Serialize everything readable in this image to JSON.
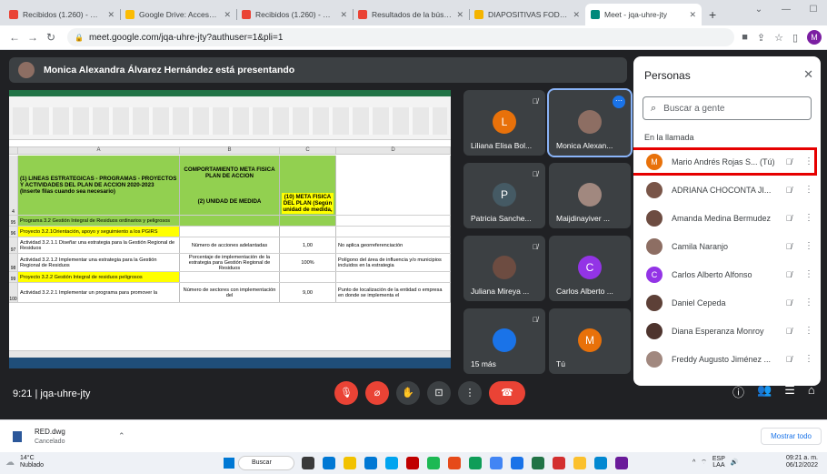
{
  "browser": {
    "tabs": [
      {
        "label": "Recibidos (1.260) - marioan",
        "color": "#ea4335"
      },
      {
        "label": "Google Drive: Acceso dene",
        "color": "#fbbc04"
      },
      {
        "label": "Recibidos (1.260) - marioan",
        "color": "#ea4335"
      },
      {
        "label": "Resultados de la búsqueda",
        "color": "#ea4335"
      },
      {
        "label": "DIAPOSITIVAS FOD-02 Seg",
        "color": "#f4b400"
      },
      {
        "label": "Meet - jqa-uhre-jty",
        "color": "#00897b"
      }
    ],
    "url": "meet.google.com/jqa-uhre-jty?authuser=1&pli=1",
    "profile_initial": "M"
  },
  "meet": {
    "presenter_text": "Monica Alexandra Álvarez Hernández está presentando",
    "meeting_time": "9:21",
    "meeting_code": "jqa-uhre-jty",
    "participants_badge": "23",
    "tiles": [
      {
        "name": "Liliana Elisa Bol...",
        "initial": "L",
        "color": "#e8710a"
      },
      {
        "name": "Monica Alexan...",
        "initial": "",
        "color": "#8d6e63"
      },
      {
        "name": "Patricia Sanche...",
        "initial": "P",
        "color": "#455a64"
      },
      {
        "name": "Maijdinayiver ...",
        "initial": "",
        "color": "#a1887f"
      },
      {
        "name": "Juliana Mireya ...",
        "initial": "",
        "color": "#6d4c41"
      },
      {
        "name": "Carlos Alberto ...",
        "initial": "C",
        "color": "#9334e6"
      },
      {
        "name": "15 más",
        "initial": "",
        "color": "#1a73e8"
      },
      {
        "name": "Tú",
        "initial": "M",
        "color": "#e8710a"
      }
    ]
  },
  "sheet": {
    "col_headers": [
      "A",
      "B",
      "C",
      "D"
    ],
    "header_a": "(1) LINEAS ESTRATEGICAS - PROGRAMAS - PROYECTOS Y ACTIVIDADES DEL PLAN DE ACCION 2020-2023",
    "header_a_note": "(Inserte filas cuando sea necesario)",
    "header_b_top": "COMPORTAMIENTO META FISICA PLAN DE ACCION",
    "header_b": "(2) UNIDAD DE MEDIDA",
    "header_c": "(10) META FISICA DEL PLAN (Según unidad de medida,",
    "rows": [
      {
        "n": "95",
        "a": "Programa 3.2 Gestión Integral de Residuos ordinarios y peligrosos",
        "b": "",
        "c": "",
        "d": "",
        "style": "green"
      },
      {
        "n": "96",
        "a": "Proyecto 3.2.1Orientación, apoyo y seguimiento a los PGIRS",
        "b": "",
        "c": "",
        "d": "",
        "style": "yellow"
      },
      {
        "n": "97",
        "a": "Actividad 3.2.1.1 Diseñar una estrategia para la Gestión Regional de Residuos",
        "b": "Número de acciones adelantadas",
        "c": "1,00",
        "d": "No aplica georreferenciación",
        "style": ""
      },
      {
        "n": "98",
        "a": "Actividad 3.2.1.2 Implementar una estrategia para la Gestión Regional de Residuos",
        "b": "Porcentaje de implementación de la estrategia para Gestión Regional de Residuos",
        "c": "100%",
        "d": "Polígono del área de influencia y/o municipios incluidos en la estrategia",
        "style": ""
      },
      {
        "n": "99",
        "a": "Proyecto 3.2.2 Gestión Integral de residuos peligrosos",
        "b": "",
        "c": "",
        "d": "",
        "style": "yellow"
      },
      {
        "n": "100",
        "a": "Actividad 3.2.2.1 Implementar un programa para promover la",
        "b": "Número de sectores con implementación del",
        "c": "9,00",
        "d": "Punto de localización de la entidad o empresa en donde se implementa el",
        "style": ""
      }
    ]
  },
  "people": {
    "title": "Personas",
    "search_placeholder": "Buscar a gente",
    "section": "En la llamada",
    "list": [
      {
        "name": "Mario Andrés Rojas S... (Tú)",
        "initial": "M",
        "color": "#e8710a",
        "highlight": true
      },
      {
        "name": "ADRIANA CHOCONTA JI...",
        "initial": "",
        "color": "#795548",
        "highlight": false
      },
      {
        "name": "Amanda Medina Bermudez",
        "initial": "",
        "color": "#6d4c41",
        "highlight": false
      },
      {
        "name": "Camila Naranjo",
        "initial": "",
        "color": "#8d6e63",
        "highlight": false
      },
      {
        "name": "Carlos Alberto Alfonso",
        "initial": "C",
        "color": "#9334e6",
        "highlight": false
      },
      {
        "name": "Daniel Cepeda",
        "initial": "",
        "color": "#5d4037",
        "highlight": false
      },
      {
        "name": "Diana Esperanza Monroy",
        "initial": "",
        "color": "#4e342e",
        "highlight": false
      },
      {
        "name": "Freddy Augusto Jiménez ...",
        "initial": "",
        "color": "#a1887f",
        "highlight": false
      }
    ]
  },
  "download": {
    "filename": "RED.dwg",
    "status": "Cancelado",
    "show_all": "Mostrar todo"
  },
  "taskbar": {
    "temp": "14°C",
    "weather": "Nublado",
    "search": "Buscar",
    "lang": "ESP",
    "lang2": "LAA",
    "time": "09:21 a. m.",
    "date": "06/12/2022"
  }
}
